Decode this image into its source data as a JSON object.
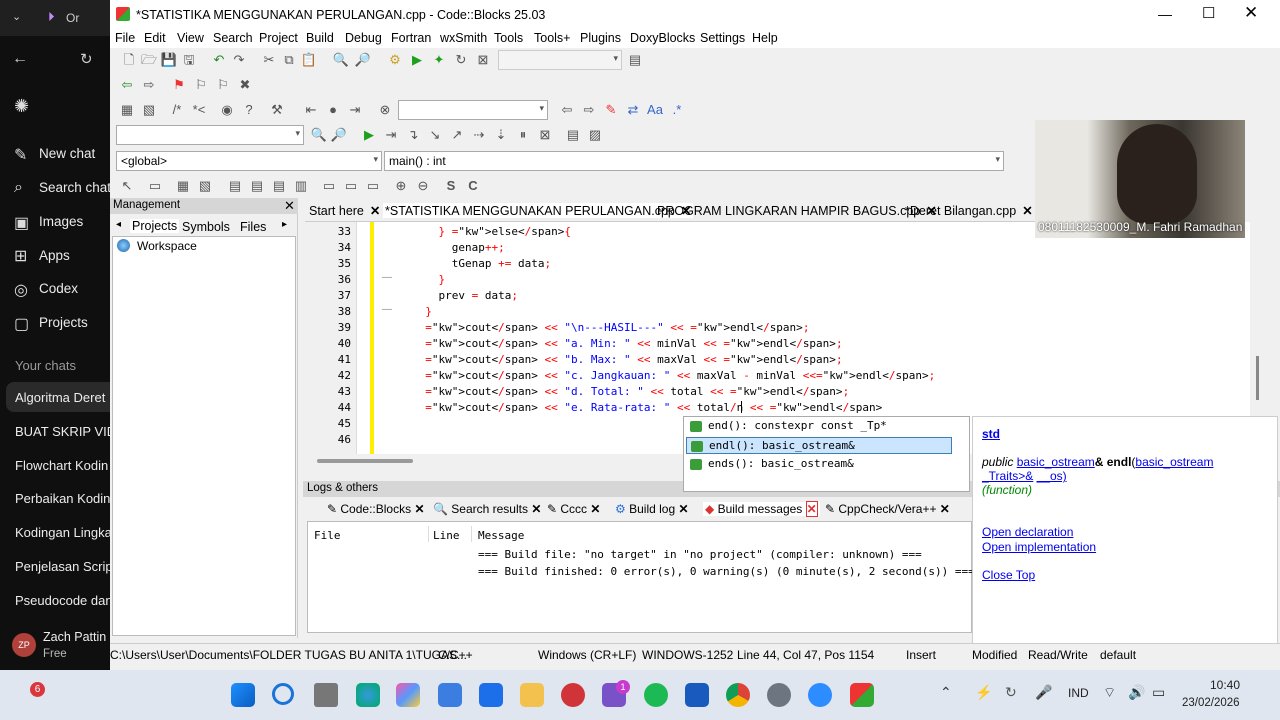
{
  "chat_sidebar": {
    "browser_tab": "Or",
    "nav": [
      {
        "label": "New chat",
        "icon": "pencil-icon"
      },
      {
        "label": "Search chats",
        "icon": "search-icon"
      },
      {
        "label": "Images",
        "icon": "image-icon"
      },
      {
        "label": "Apps",
        "icon": "apps-icon"
      },
      {
        "label": "Codex",
        "icon": "codex-icon"
      },
      {
        "label": "Projects",
        "icon": "folder-icon"
      }
    ],
    "section_label": "Your chats",
    "chats": [
      "Algoritma Deret",
      "BUAT SKRIP VID",
      "Flowchart Kodin",
      "Perbaikan Kodin",
      "Kodingan Lingka",
      "Penjelasan Scrip",
      "Pseudocode dan"
    ],
    "user": {
      "initials": "ZP",
      "name": "Zach Pattin",
      "plan": "Free"
    }
  },
  "window": {
    "title": "*STATISTIKA MENGGUNAKAN PERULANGAN.cpp - Code::Blocks 25.03",
    "menu": [
      "File",
      "Edit",
      "View",
      "Search",
      "Project",
      "Build",
      "Debug",
      "Fortran",
      "wxSmith",
      "Tools",
      "Tools+",
      "Plugins",
      "DoxyBlocks",
      "Settings",
      "Help"
    ],
    "scope_combo": "<global>",
    "function_combo": "main() : int"
  },
  "management": {
    "title": "Management",
    "tabs": [
      "Projects",
      "Symbols",
      "Files"
    ],
    "tree_root": "Workspace"
  },
  "editor": {
    "tabs": [
      "Start here",
      "*STATISTIKA MENGGUNAKAN PERULANGAN.cpp",
      "PROGRAM LINGKARAN HAMPIR BAGUS.cpp",
      "*Deret Bilangan.cpp"
    ],
    "lines": [
      {
        "n": "33",
        "text": "    } else{"
      },
      {
        "n": "34",
        "text": "      genap++;"
      },
      {
        "n": "35",
        "text": "      tGenap += data;"
      },
      {
        "n": "36",
        "text": "    }"
      },
      {
        "n": "37",
        "text": "    prev = data;"
      },
      {
        "n": "38",
        "text": "  }"
      },
      {
        "n": "39",
        "text": "  cout << \"\\n---HASIL---\" << endl;"
      },
      {
        "n": "40",
        "text": "  cout << \"a. Min: \" << minVal << endl;"
      },
      {
        "n": "41",
        "text": "  cout << \"b. Max: \" << maxVal << endl;"
      },
      {
        "n": "42",
        "text": "  cout << \"c. Jangkauan: \" << maxVal - minVal <<endl;"
      },
      {
        "n": "43",
        "text": "  cout << \"d. Total: \" << total << endl;"
      },
      {
        "n": "44",
        "text": "  cout << \"e. Rata-rata: \" << total/n << endl"
      },
      {
        "n": "45",
        "text": ""
      },
      {
        "n": "46",
        "text": ""
      }
    ]
  },
  "autocomplete": {
    "items": [
      "end(): constexpr const _Tp*",
      "endl(): basic_ostream&",
      "ends(): basic_ostream&"
    ],
    "selected": 1
  },
  "doc_popup": {
    "namespace": "std",
    "sig_prefix": "public",
    "sig_type": "basic_ostream",
    "sig_amp": "& ",
    "sig_name": "endl",
    "sig_paren": "(",
    "sig_param1": "basic_ostream",
    "sig_param2": "_Traits>&",
    "sig_param3": "__os)",
    "kind": "(function)",
    "open_declaration": "Open declaration",
    "open_implementation": "Open implementation",
    "close": "Close Top"
  },
  "logs": {
    "title": "Logs & others",
    "tabs": [
      "Code::Blocks",
      "Search results",
      "Cccc",
      "Build log",
      "Build messages",
      "CppCheck/Vera++"
    ],
    "columns": [
      "File",
      "Line",
      "Message"
    ],
    "messages": [
      "=== Build file: \"no target\" in \"no project\" (compiler: unknown) ===",
      "=== Build finished: 0 error(s), 0 warning(s) (0 minute(s), 2 second(s)) ==="
    ]
  },
  "status": {
    "path": "C:\\Users\\User\\Documents\\FOLDER TUGAS BU ANITA 1\\TUGAS...",
    "language": "C/C++",
    "eol": "Windows (CR+LF)",
    "encoding": "WINDOWS-1252",
    "position": "Line 44, Col 47, Pos 1154",
    "mode": "Insert",
    "modified": "Modified",
    "rw": "Read/Write",
    "default": "default"
  },
  "webcam": {
    "caption": "08011182530009_M. Fahri Ramadhan"
  },
  "taskbar": {
    "language": "IND",
    "time": "10:40",
    "date": "23/02/2026",
    "badge_chrome": "6",
    "badge_app": "1"
  }
}
